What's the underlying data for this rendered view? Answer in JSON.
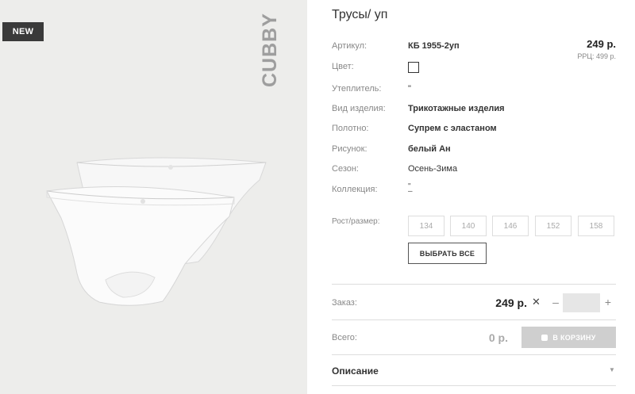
{
  "product": {
    "badge": "NEW",
    "brand": "CUBBY",
    "title": "Трусы/ уп",
    "price": "249 р.",
    "rrp": "РРЦ: 499 р."
  },
  "specs": [
    {
      "label": "Артикул:",
      "value": "КБ 1955-2уп"
    },
    {
      "label": "Цвет:",
      "value": ""
    },
    {
      "label": "Утеплитель:",
      "value": "\""
    },
    {
      "label": "Вид изделия:",
      "value": "Трикотажные изделия"
    },
    {
      "label": "Полотно:",
      "value": "Супрем с эластаном"
    },
    {
      "label": "Рисунок:",
      "value": "белый Ан"
    },
    {
      "label": "Сезон:",
      "value": "Осень-Зима"
    },
    {
      "label": "Коллекция:",
      "value": "\""
    }
  ],
  "collection_extra": "–",
  "sizes": {
    "label": "Рост/размер:",
    "options": [
      "134",
      "140",
      "146",
      "152",
      "158"
    ],
    "select_all": "ВЫБРАТЬ ВСЕ"
  },
  "order": {
    "label": "Заказ:",
    "price": "249 р.",
    "times": "✕",
    "minus": "–",
    "plus": "+",
    "quantity": ""
  },
  "total": {
    "label": "Всего:",
    "value": "0 р.",
    "cart_button": "В КОРЗИНУ"
  },
  "description": {
    "label": "Описание",
    "chevron": "▼"
  }
}
